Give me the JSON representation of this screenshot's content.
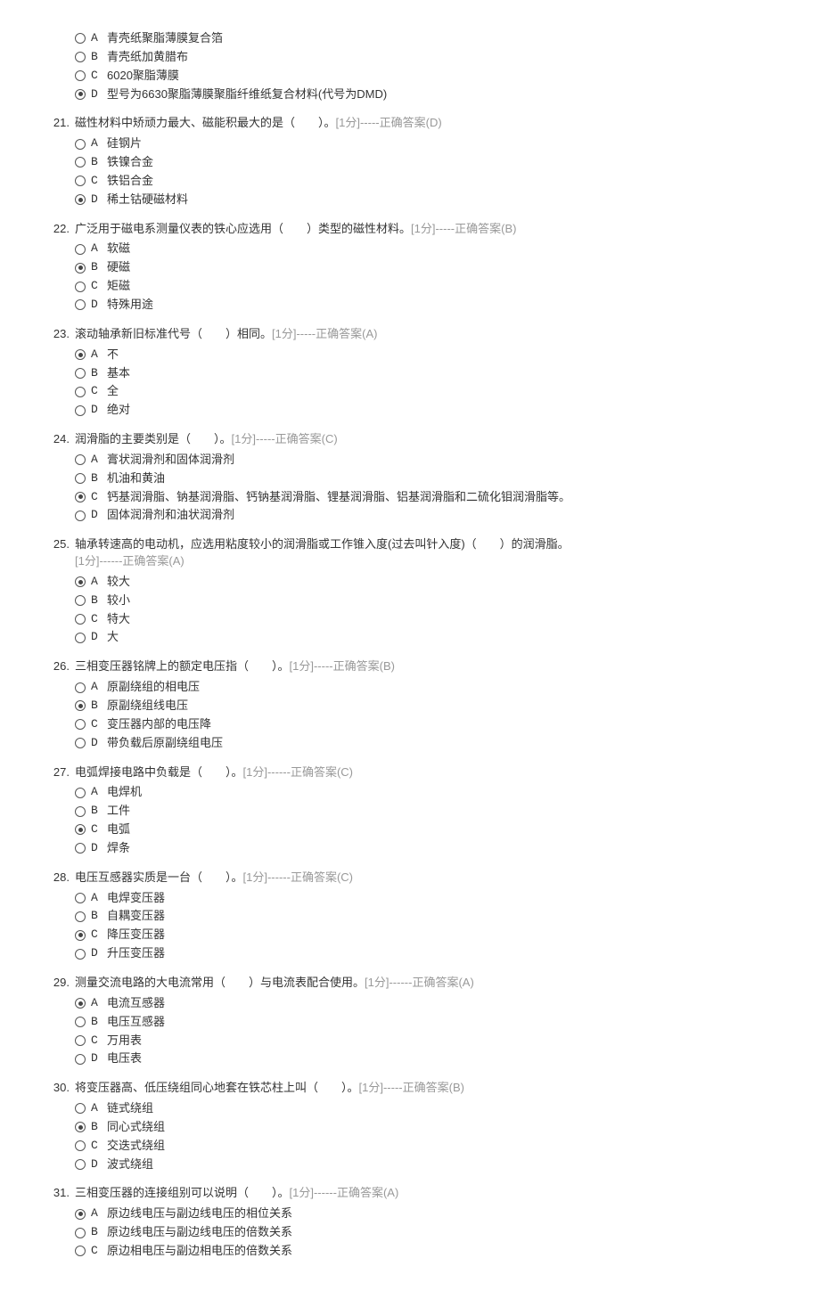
{
  "questions": [
    {
      "num": "",
      "stem": "",
      "meta": "",
      "options": [
        {
          "label": "A",
          "text": "青壳纸聚脂薄膜复合箔",
          "selected": false
        },
        {
          "label": "B",
          "text": "青壳纸加黄腊布",
          "selected": false
        },
        {
          "label": "C",
          "text": "6020聚脂薄膜",
          "selected": false
        },
        {
          "label": "D",
          "text": "型号为6630聚脂薄膜聚脂纤维纸复合材料(代号为DMD)",
          "selected": true
        }
      ]
    },
    {
      "num": "21.",
      "stem": "磁性材料中矫顽力最大、磁能积最大的是（　　）。",
      "meta": "[1分]-----正确答案(D)",
      "options": [
        {
          "label": "A",
          "text": "硅钢片",
          "selected": false
        },
        {
          "label": "B",
          "text": "铁镍合金",
          "selected": false
        },
        {
          "label": "C",
          "text": "铁铝合金",
          "selected": false
        },
        {
          "label": "D",
          "text": "稀土钴硬磁材料",
          "selected": true
        }
      ]
    },
    {
      "num": "22.",
      "stem": "广泛用于磁电系测量仪表的铁心应选用（　　）类型的磁性材料。",
      "meta": "[1分]-----正确答案(B)",
      "options": [
        {
          "label": "A",
          "text": "软磁",
          "selected": false
        },
        {
          "label": "B",
          "text": "硬磁",
          "selected": true
        },
        {
          "label": "C",
          "text": "矩磁",
          "selected": false
        },
        {
          "label": "D",
          "text": "特殊用途",
          "selected": false
        }
      ]
    },
    {
      "num": "23.",
      "stem": "滚动轴承新旧标准代号（　　）相同。",
      "meta": "[1分]-----正确答案(A)",
      "options": [
        {
          "label": "A",
          "text": "不",
          "selected": true
        },
        {
          "label": "B",
          "text": "基本",
          "selected": false
        },
        {
          "label": "C",
          "text": "全",
          "selected": false
        },
        {
          "label": "D",
          "text": "绝对",
          "selected": false
        }
      ]
    },
    {
      "num": "24.",
      "stem": "润滑脂的主要类别是（　　）。",
      "meta": "[1分]-----正确答案(C)",
      "options": [
        {
          "label": "A",
          "text": "膏状润滑剂和固体润滑剂",
          "selected": false
        },
        {
          "label": "B",
          "text": "机油和黄油",
          "selected": false
        },
        {
          "label": "C",
          "text": "钙基润滑脂、钠基润滑脂、钙钠基润滑脂、锂基润滑脂、铝基润滑脂和二硫化钼润滑脂等。",
          "selected": true
        },
        {
          "label": "D",
          "text": "固体润滑剂和油状润滑剂",
          "selected": false
        }
      ]
    },
    {
      "num": "25.",
      "stem": "轴承转速高的电动机，应选用粘度较小的润滑脂或工作锥入度(过去叫针入度)（　　）的润滑脂。",
      "meta": "[1分]------正确答案(A)",
      "metaNewline": true,
      "options": [
        {
          "label": "A",
          "text": "较大",
          "selected": true
        },
        {
          "label": "B",
          "text": "较小",
          "selected": false
        },
        {
          "label": "C",
          "text": "特大",
          "selected": false
        },
        {
          "label": "D",
          "text": "大",
          "selected": false
        }
      ]
    },
    {
      "num": "26.",
      "stem": "三相变压器铭牌上的额定电压指（　　）。",
      "meta": "[1分]-----正确答案(B)",
      "options": [
        {
          "label": "A",
          "text": "原副绕组的相电压",
          "selected": false
        },
        {
          "label": "B",
          "text": "原副绕组线电压",
          "selected": true
        },
        {
          "label": "C",
          "text": "变压器内部的电压降",
          "selected": false
        },
        {
          "label": "D",
          "text": "带负载后原副绕组电压",
          "selected": false
        }
      ]
    },
    {
      "num": "27.",
      "stem": "电弧焊接电路中负载是（　　）。",
      "meta": "[1分]------正确答案(C)",
      "options": [
        {
          "label": "A",
          "text": "电焊机",
          "selected": false
        },
        {
          "label": "B",
          "text": "工件",
          "selected": false
        },
        {
          "label": "C",
          "text": "电弧",
          "selected": true
        },
        {
          "label": "D",
          "text": "焊条",
          "selected": false
        }
      ]
    },
    {
      "num": "28.",
      "stem": "电压互感器实质是一台（　　）。",
      "meta": "[1分]------正确答案(C)",
      "options": [
        {
          "label": "A",
          "text": "电焊变压器",
          "selected": false
        },
        {
          "label": "B",
          "text": "自耦变压器",
          "selected": false
        },
        {
          "label": "C",
          "text": "降压变压器",
          "selected": true
        },
        {
          "label": "D",
          "text": "升压变压器",
          "selected": false
        }
      ]
    },
    {
      "num": "29.",
      "stem": "测量交流电路的大电流常用（　　）与电流表配合使用。",
      "meta": "[1分]------正确答案(A)",
      "options": [
        {
          "label": "A",
          "text": "电流互感器",
          "selected": true
        },
        {
          "label": "B",
          "text": "电压互感器",
          "selected": false
        },
        {
          "label": "C",
          "text": "万用表",
          "selected": false
        },
        {
          "label": "D",
          "text": "电压表",
          "selected": false
        }
      ]
    },
    {
      "num": "30.",
      "stem": "将变压器高、低压绕组同心地套在铁芯柱上叫（　　）。",
      "meta": "[1分]-----正确答案(B)",
      "options": [
        {
          "label": "A",
          "text": "链式绕组",
          "selected": false
        },
        {
          "label": "B",
          "text": "同心式绕组",
          "selected": true
        },
        {
          "label": "C",
          "text": "交迭式绕组",
          "selected": false
        },
        {
          "label": "D",
          "text": "波式绕组",
          "selected": false
        }
      ]
    },
    {
      "num": "31.",
      "stem": "三相变压器的连接组别可以说明（　　）。",
      "meta": "[1分]------正确答案(A)",
      "options": [
        {
          "label": "A",
          "text": "原边线电压与副边线电压的相位关系",
          "selected": true
        },
        {
          "label": "B",
          "text": "原边线电压与副边线电压的倍数关系",
          "selected": false
        },
        {
          "label": "C",
          "text": "原边相电压与副边相电压的倍数关系",
          "selected": false
        }
      ]
    }
  ]
}
